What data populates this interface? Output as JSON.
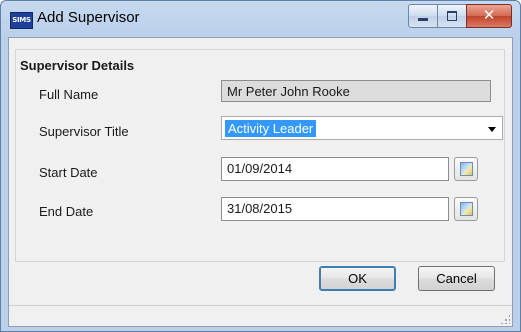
{
  "window": {
    "app_icon_text": "SIMS",
    "title": "Add Supervisor",
    "close_symbol": "✕"
  },
  "group": {
    "title": "Supervisor Details",
    "fields": {
      "full_name_label": "Full Name",
      "full_name_value": "Mr Peter John Rooke",
      "title_label": "Supervisor Title",
      "title_value": "Activity Leader",
      "start_label": "Start Date",
      "start_value": "01/09/2014",
      "end_label": "End Date",
      "end_value": "31/08/2015"
    }
  },
  "buttons": {
    "ok": "OK",
    "cancel": "Cancel"
  },
  "icons": {
    "app": "sims-logo-icon",
    "minimize": "minimize-icon",
    "maximize": "maximize-icon",
    "close": "close-icon",
    "dropdown": "chevron-down-icon",
    "calendar": "calendar-icon",
    "grip": "resize-grip-icon"
  },
  "colors": {
    "selection": "#3399ff",
    "close_button": "#c2432c",
    "frame": "#b9cfea"
  }
}
